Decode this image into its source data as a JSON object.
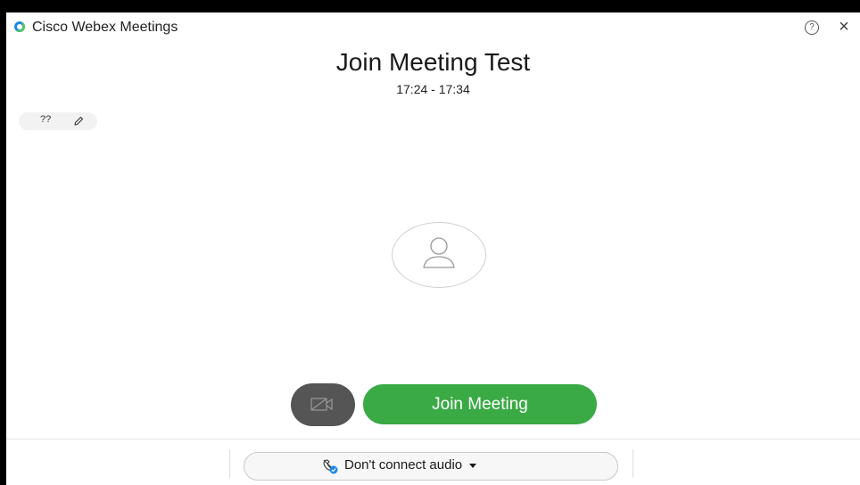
{
  "window": {
    "title": "Cisco Webex Meetings",
    "help_glyph": "?",
    "close_glyph": "×"
  },
  "meeting": {
    "title": "Join Meeting Test",
    "time": "17:24 - 17:34"
  },
  "name_chip": {
    "name": "??",
    "edit_icon": "pencil-icon"
  },
  "avatar": {
    "icon": "user-icon"
  },
  "video_button": {
    "icon": "video-off-icon"
  },
  "join_button": {
    "label": "Join Meeting"
  },
  "audio_button": {
    "label": "Don't connect audio",
    "icon": "audio-off-icon"
  },
  "colors": {
    "join_green": "#3aaa45",
    "video_gray": "#555555",
    "audio_blue": "#1e88e5"
  }
}
